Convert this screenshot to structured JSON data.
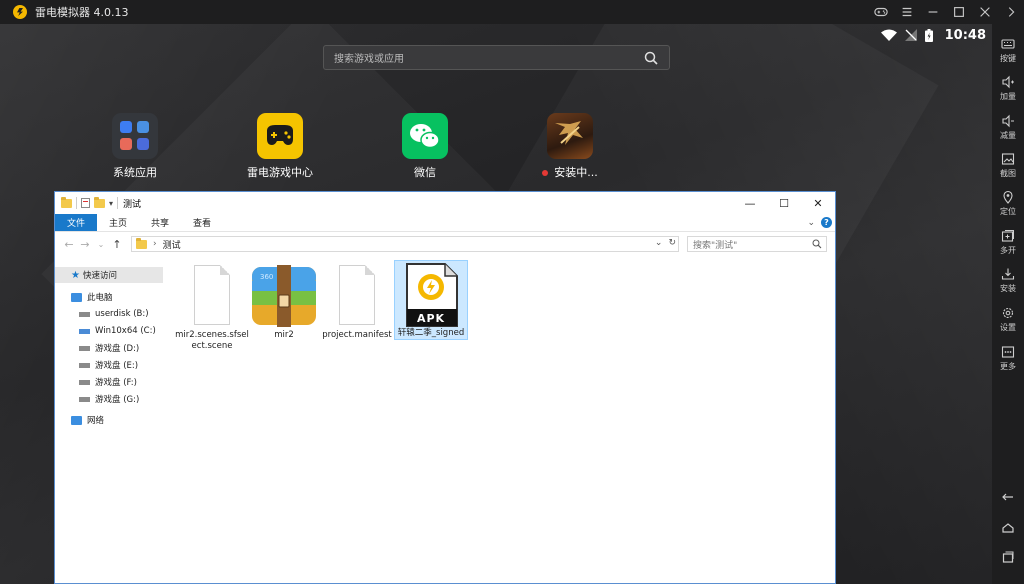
{
  "window": {
    "title": "雷电模拟器 4.0.13"
  },
  "status": {
    "time": "10:48"
  },
  "android": {
    "search_placeholder": "搜索游戏或应用",
    "apps": [
      {
        "label": "系统应用",
        "icon": "system-apps-folder-icon"
      },
      {
        "label": "雷电游戏中心",
        "icon": "gamepad-icon"
      },
      {
        "label": "微信",
        "icon": "wechat-icon"
      },
      {
        "label": "安装中...",
        "icon": "game-icon",
        "badge_color": "#e53935"
      }
    ]
  },
  "sidebar": {
    "items": [
      {
        "label": "按键",
        "icon": "keyboard-icon"
      },
      {
        "label": "加量",
        "icon": "volume-up-icon"
      },
      {
        "label": "减量",
        "icon": "volume-down-icon"
      },
      {
        "label": "截图",
        "icon": "screenshot-icon"
      },
      {
        "label": "定位",
        "icon": "location-icon"
      },
      {
        "label": "多开",
        "icon": "multi-instance-icon"
      },
      {
        "label": "安装",
        "icon": "install-icon"
      },
      {
        "label": "设置",
        "icon": "settings-icon"
      },
      {
        "label": "更多",
        "icon": "more-icon"
      }
    ]
  },
  "explorer": {
    "title": "测试",
    "ribbon_tabs": [
      "文件",
      "主页",
      "共享",
      "查看"
    ],
    "address": "测试",
    "search_placeholder": "搜索\"测试\"",
    "nav": {
      "quick_access": "快速访问",
      "this_pc": "此电脑",
      "drives": [
        "userdisk (B:)",
        "Win10x64 (C:)",
        "游戏盘 (D:)",
        "游戏盘 (E:)",
        "游戏盘 (F:)",
        "游戏盘 (G:)"
      ],
      "network": "网络"
    },
    "files": [
      {
        "name": "mir2.scenes.sfselect.scene",
        "icon": "blank-file-icon"
      },
      {
        "name": "mir2",
        "icon": "archive-icon"
      },
      {
        "name": "project.manifest",
        "icon": "blank-file-icon"
      },
      {
        "name": "轩辕二季_signed",
        "icon": "apk-file-icon",
        "badge": "APK"
      }
    ]
  },
  "colors": {
    "accent_blue": "#1979ca",
    "ldplayer_yellow": "#f5b800",
    "wechat_green": "#07c160"
  }
}
